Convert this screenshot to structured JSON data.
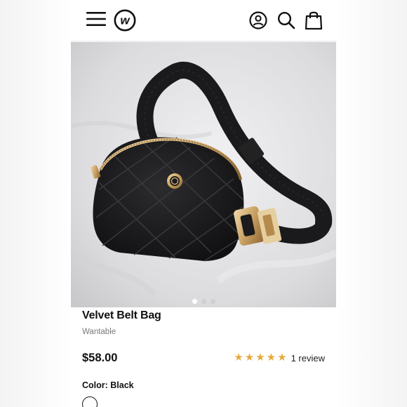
{
  "header": {
    "menu_icon": "hamburger-menu-icon",
    "logo_icon": "wantable-logo-icon",
    "account_icon": "account-icon",
    "search_icon": "search-icon",
    "bag_icon": "shopping-bag-icon",
    "logo_letter": "w"
  },
  "gallery": {
    "image_subject": "black quilted velvet belt bag with gold zipper and buckle",
    "dot_count": 3,
    "active_dot": 1
  },
  "product": {
    "title": "Velvet Belt Bag",
    "brand": "Wantable",
    "price": "$58.00",
    "rating": 5,
    "review_count_label": "1 review",
    "color_label": "Color: ",
    "color_value": "Black",
    "colors": {
      "accent_star": "#e8a93a",
      "text": "#111111",
      "subtle": "#7a7a7a"
    }
  }
}
